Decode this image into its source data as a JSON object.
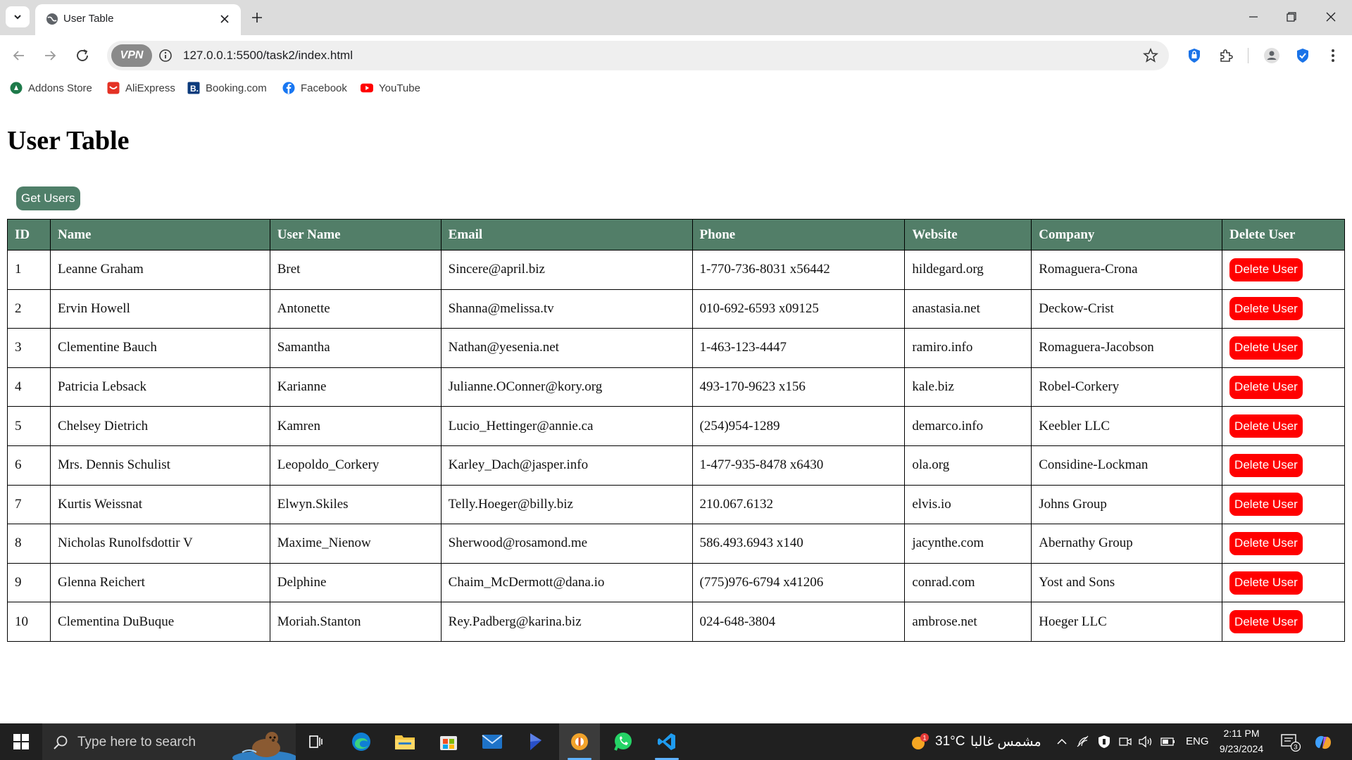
{
  "browser": {
    "tab_title": "User Table",
    "url": "127.0.0.1:5500/task2/index.html",
    "vpn_label": "VPN",
    "bookmarks": [
      {
        "label": "Addons Store",
        "icon": "addons-store-icon"
      },
      {
        "label": "AliExpress",
        "icon": "aliexpress-icon"
      },
      {
        "label": "Booking.com",
        "icon": "booking-icon"
      },
      {
        "label": "Facebook",
        "icon": "facebook-icon"
      },
      {
        "label": "YouTube",
        "icon": "youtube-icon"
      }
    ]
  },
  "page": {
    "title": "User Table",
    "get_users_label": "Get Users",
    "colors": {
      "header_bg": "#527e68",
      "button_bg": "#4f7f69",
      "delete_bg": "#ff0000"
    }
  },
  "table": {
    "headers": [
      "ID",
      "Name",
      "User Name",
      "Email",
      "Phone",
      "Website",
      "Company",
      "Delete User"
    ],
    "delete_label": "Delete User",
    "rows": [
      [
        "1",
        "Leanne Graham",
        "Bret",
        "Sincere@april.biz",
        "1-770-736-8031 x56442",
        "hildegard.org",
        "Romaguera-Crona"
      ],
      [
        "2",
        "Ervin Howell",
        "Antonette",
        "Shanna@melissa.tv",
        "010-692-6593 x09125",
        "anastasia.net",
        "Deckow-Crist"
      ],
      [
        "3",
        "Clementine Bauch",
        "Samantha",
        "Nathan@yesenia.net",
        "1-463-123-4447",
        "ramiro.info",
        "Romaguera-Jacobson"
      ],
      [
        "4",
        "Patricia Lebsack",
        "Karianne",
        "Julianne.OConner@kory.org",
        "493-170-9623 x156",
        "kale.biz",
        "Robel-Corkery"
      ],
      [
        "5",
        "Chelsey Dietrich",
        "Kamren",
        "Lucio_Hettinger@annie.ca",
        "(254)954-1289",
        "demarco.info",
        "Keebler LLC"
      ],
      [
        "6",
        "Mrs. Dennis Schulist",
        "Leopoldo_Corkery",
        "Karley_Dach@jasper.info",
        "1-477-935-8478 x6430",
        "ola.org",
        "Considine-Lockman"
      ],
      [
        "7",
        "Kurtis Weissnat",
        "Elwyn.Skiles",
        "Telly.Hoeger@billy.biz",
        "210.067.6132",
        "elvis.io",
        "Johns Group"
      ],
      [
        "8",
        "Nicholas Runolfsdottir V",
        "Maxime_Nienow",
        "Sherwood@rosamond.me",
        "586.493.6943 x140",
        "jacynthe.com",
        "Abernathy Group"
      ],
      [
        "9",
        "Glenna Reichert",
        "Delphine",
        "Chaim_McDermott@dana.io",
        "(775)976-6794 x41206",
        "conrad.com",
        "Yost and Sons"
      ],
      [
        "10",
        "Clementina DuBuque",
        "Moriah.Stanton",
        "Rey.Padberg@karina.biz",
        "024-648-3804",
        "ambrose.net",
        "Hoeger LLC"
      ]
    ]
  },
  "taskbar": {
    "search_placeholder": "Type here to search",
    "weather_temp": "31°C",
    "weather_text": "مشمس غالبا",
    "weather_badge": "1",
    "language": "ENG",
    "time": "2:11 PM",
    "date": "9/23/2024",
    "notification_count": "3",
    "apps": [
      "task-view-icon",
      "edge-icon",
      "file-explorer-icon",
      "store-icon",
      "mail-icon",
      "copilot-icon",
      "browser-icon",
      "whatsapp-icon",
      "vscode-icon"
    ]
  }
}
